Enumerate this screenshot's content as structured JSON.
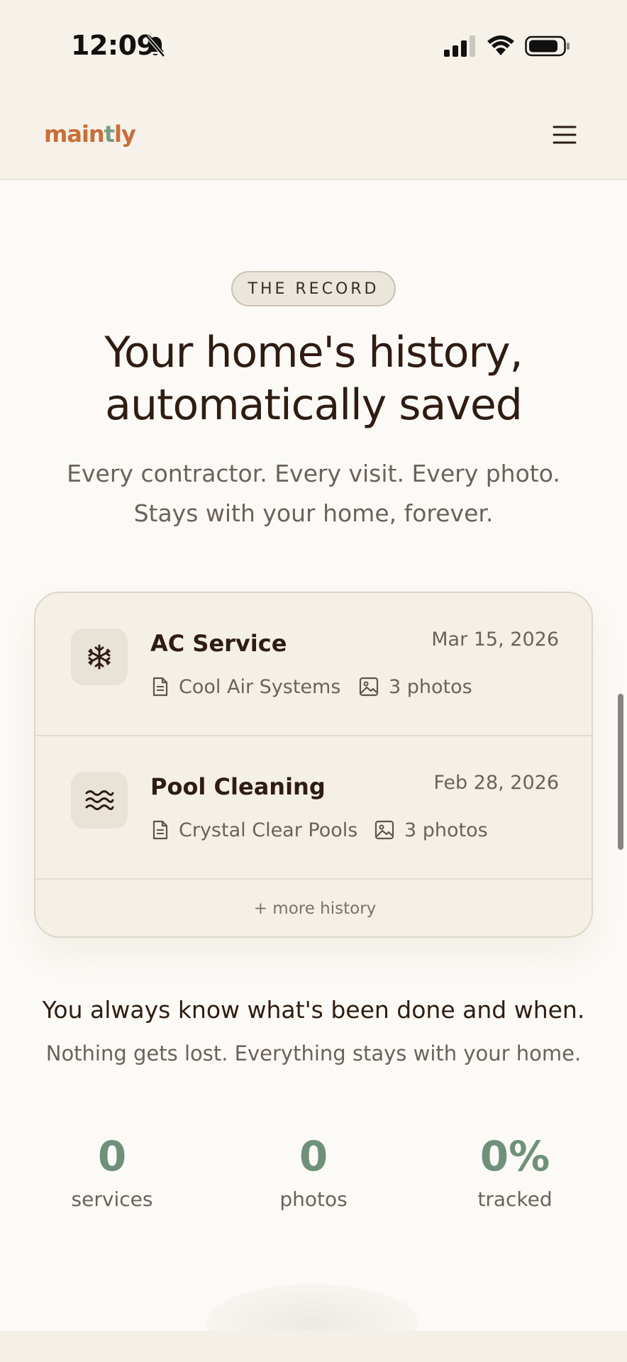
{
  "status_bar": {
    "time": "12:09",
    "icons": [
      "bell-slash-icon",
      "cellular-signal-icon",
      "wifi-icon",
      "battery-icon"
    ]
  },
  "header": {
    "logo": {
      "part1": "main",
      "part2": "t",
      "part3": "ly"
    },
    "menu_icon": "hamburger-menu-icon",
    "colors": {
      "logo_orange": "#c86f3a",
      "logo_green": "#7a9b82"
    }
  },
  "hero": {
    "badge": "THE RECORD",
    "title_line1": "Your home's history,",
    "title_line2": "automatically saved",
    "subtitle_line1": "Every contractor. Every visit. Every photo.",
    "subtitle_line2": "Stays with your home, forever."
  },
  "history": {
    "records": [
      {
        "icon": "snowflake-icon",
        "title": "AC Service",
        "date": "Mar 15, 2026",
        "contractor": "Cool Air Systems",
        "photos": "3 photos"
      },
      {
        "icon": "water-waves-icon",
        "title": "Pool Cleaning",
        "date": "Feb 28, 2026",
        "contractor": "Crystal Clear Pools",
        "photos": "3 photos"
      }
    ],
    "more_label": "+ more history"
  },
  "summary": {
    "title": "You always know what's been done and when.",
    "subtitle": "Nothing gets lost. Everything stays with your home."
  },
  "stats": [
    {
      "value": "0",
      "label": "services"
    },
    {
      "value": "0",
      "label": "photos"
    },
    {
      "value": "0%",
      "label": "tracked"
    }
  ],
  "colors": {
    "background": "#fcfaf6",
    "card": "#f5f0e6",
    "stat_green": "#6f9079",
    "text_dark": "#2f1c12",
    "text_muted": "#6b625a"
  }
}
